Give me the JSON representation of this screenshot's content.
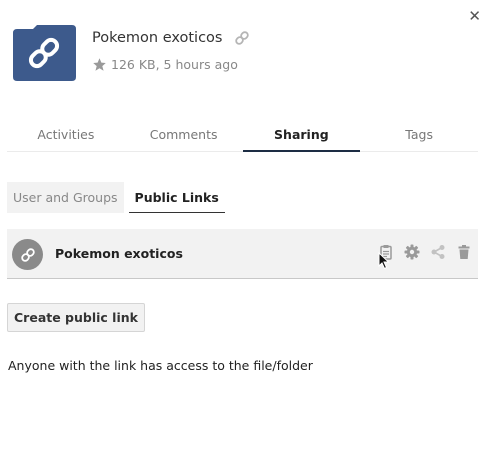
{
  "colors": {
    "folder_blue": "#3d5a8c",
    "tab_underline": "#1d2d44",
    "avatar_gray": "#8a8a8a",
    "icon_gray": "#9a9a9a"
  },
  "header": {
    "close_icon": "close-icon",
    "file_icon": "link-file-icon",
    "title": "Pokemon exoticos",
    "title_icon": "link-icon",
    "favorite_icon": "star-icon",
    "meta": "126 KB, 5 hours ago"
  },
  "tabs": [
    {
      "label": "Activities",
      "active": false
    },
    {
      "label": "Comments",
      "active": false
    },
    {
      "label": "Sharing",
      "active": true
    },
    {
      "label": "Tags",
      "active": false
    }
  ],
  "subtabs": [
    {
      "label": "User and Groups",
      "active": false
    },
    {
      "label": "Public Links",
      "active": true
    }
  ],
  "public_link": {
    "name": "Pokemon exoticos",
    "icons": [
      "clipboard-icon",
      "gear-icon",
      "share-icon",
      "trash-icon"
    ]
  },
  "create_button": "Create public link",
  "info_text": "Anyone with the link has access to the file/folder"
}
